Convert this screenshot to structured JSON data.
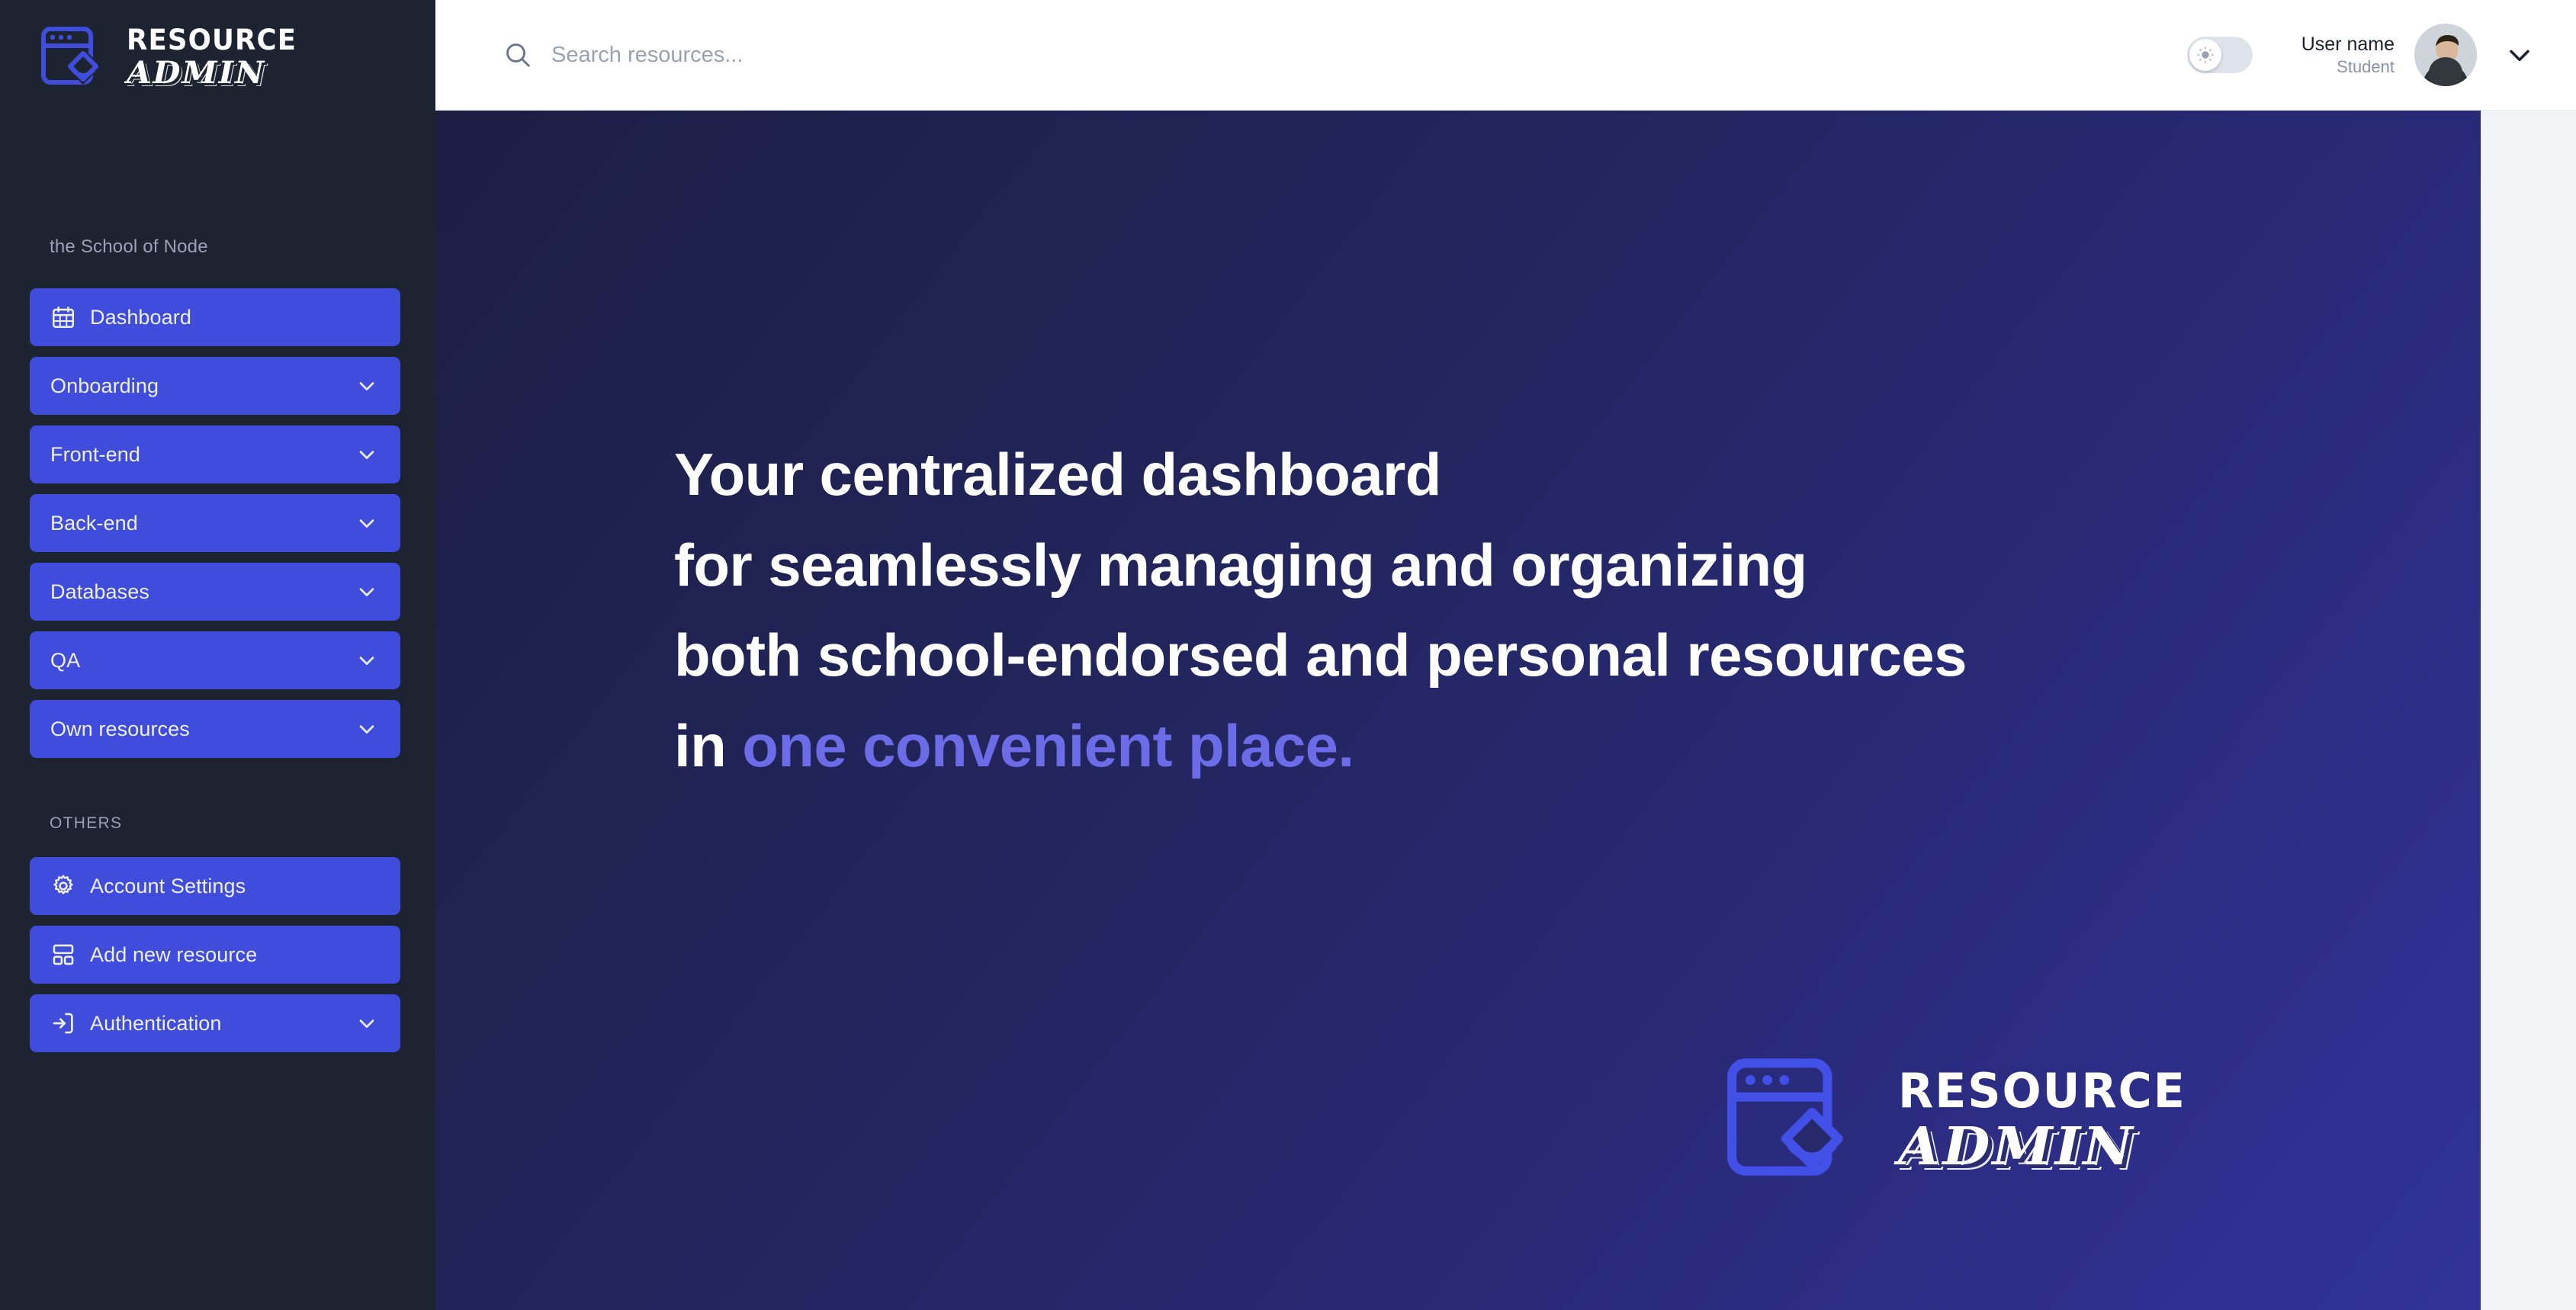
{
  "brand": {
    "line1": "RESOURCE",
    "line2": "ADMIN",
    "icon": "browser-graduation-cap-logo"
  },
  "sidebar": {
    "school_label": "the School of Node",
    "others_label": "OTHERS",
    "primary_items": [
      {
        "label": "Dashboard",
        "icon": "calendar-icon",
        "has_chevron": false
      },
      {
        "label": "Onboarding",
        "icon": "",
        "has_chevron": true
      },
      {
        "label": "Front-end",
        "icon": "",
        "has_chevron": true
      },
      {
        "label": "Back-end",
        "icon": "",
        "has_chevron": true
      },
      {
        "label": "Databases",
        "icon": "",
        "has_chevron": true
      },
      {
        "label": "QA",
        "icon": "",
        "has_chevron": true
      },
      {
        "label": "Own resources",
        "icon": "",
        "has_chevron": true
      }
    ],
    "secondary_items": [
      {
        "label": "Account Settings",
        "icon": "gear-icon",
        "has_chevron": false
      },
      {
        "label": "Add new resource",
        "icon": "layout-blocks-icon",
        "has_chevron": false
      },
      {
        "label": "Authentication",
        "icon": "login-arrow-icon",
        "has_chevron": true
      }
    ]
  },
  "topbar": {
    "search": {
      "placeholder": "Search resources...",
      "value": "",
      "icon": "search-icon"
    },
    "theme_toggle": {
      "state": "off",
      "icon": "sun-icon"
    },
    "user": {
      "name": "User name",
      "role": "Student",
      "avatar": "user-photo-avatar",
      "chevron": "chevron-down-icon"
    }
  },
  "hero": {
    "lines": [
      {
        "text": "Your centralized dashboard",
        "accent": ""
      },
      {
        "text": "for seamlessly managing and organizing",
        "accent": ""
      },
      {
        "text": "both school-endorsed and personal resources",
        "accent": ""
      },
      {
        "text": "in ",
        "accent": "one convenient place."
      }
    ],
    "logo": {
      "line1": "RESOURCE",
      "line2": "ADMIN",
      "icon": "browser-graduation-cap-logo"
    }
  },
  "colors": {
    "sidebar_bg": "#1E2332",
    "nav_item_bg": "#3F4CDC",
    "hero_gradient_start": "#1C1E44",
    "hero_gradient_end": "#32329A",
    "accent_text": "#6C6CE8",
    "page_bg": "#F1F3F7",
    "logo_icon": "#3F4CDC"
  }
}
